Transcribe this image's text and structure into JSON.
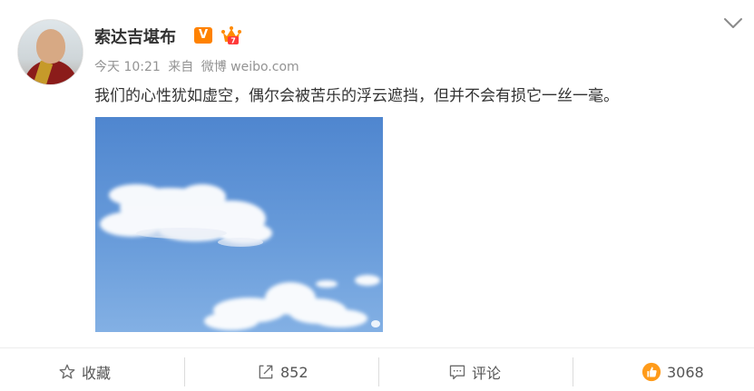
{
  "post": {
    "author": "索达吉堪布",
    "verified_badge": "V",
    "time": "今天 10:21",
    "source_prefix": "来自",
    "source": "微博 weibo.com",
    "text": "我们的心性犹如虚空，偶尔会被苦乐的浮云遮挡，但并不会有损它一丝一毫。",
    "image": "sky-with-clouds"
  },
  "actions": {
    "favorite_label": "收藏",
    "repost_count": "852",
    "comment_label": "评论",
    "like_count": "3068"
  },
  "colors": {
    "accent_orange": "#ff8200",
    "sky_blue": "#5a8fd0",
    "text_gray": "#939393"
  }
}
